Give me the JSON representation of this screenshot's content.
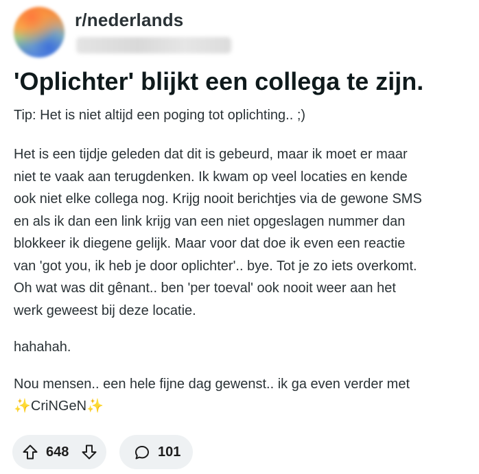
{
  "post": {
    "subreddit": "r/nederlands",
    "title": "'Oplichter' blijkt een collega te zijn.",
    "tip": "Tip: Het is niet altijd een poging tot oplichting.. ;)",
    "paragraph1_lines": [
      "Het is een tijdje geleden dat dit is gebeurd, maar ik moet er maar",
      "niet te vaak aan terugdenken. Ik kwam op veel locaties en kende",
      "ook niet elke collega nog. Krijg nooit berichtjes via de gewone SMS",
      "en als ik dan een link krijg van een niet opgeslagen nummer dan",
      "blokkeer ik diegene gelijk. Maar voor dat doe ik even een reactie",
      "van 'got you, ik heb je door oplichter'.. bye. Tot je zo iets overkomt.",
      "Oh wat was dit gênant.. ben 'per toeval' ook nooit weer aan het",
      "werk geweest bij deze locatie."
    ],
    "paragraph2": "hahahah.",
    "paragraph3_lines": [
      "Nou mensen.. een hele fijne dag gewenst.. ik ga even verder met",
      "✨CriNGeN✨"
    ]
  },
  "actions": {
    "vote_count": "648",
    "comment_count": "101"
  },
  "icons": {
    "upvote": "arrow-up-outline",
    "downvote": "arrow-down-outline",
    "comment": "speech-bubble-outline"
  },
  "colors": {
    "pill_bg": "#eef1f3",
    "title_text": "#0f1a1c",
    "body_text": "#2a3236"
  }
}
